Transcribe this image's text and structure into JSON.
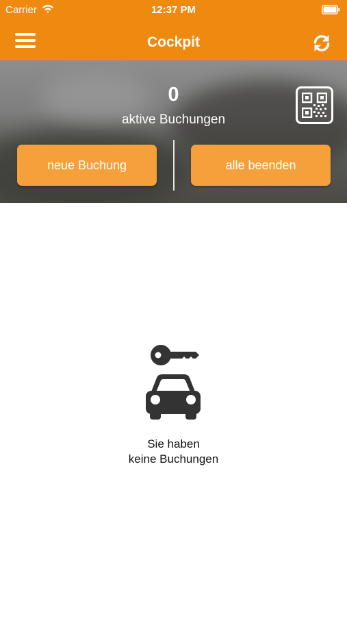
{
  "status_bar": {
    "carrier": "Carrier",
    "time": "12:37 PM",
    "icons": [
      "wifi-icon",
      "battery-icon"
    ]
  },
  "nav_bar": {
    "title": "Cockpit",
    "left_icon": "hamburger-menu-icon",
    "right_icon": "refresh-icon"
  },
  "summary": {
    "active_count": "0",
    "active_label": "aktive Buchungen",
    "qr_icon": "qr-code-icon",
    "new_booking_label": "neue Buchung",
    "end_all_label": "alle beenden"
  },
  "empty_state": {
    "icon": "car-key-icon",
    "line1": "Sie haben",
    "line2": "keine Buchungen"
  },
  "colors": {
    "brand_orange": "#f0890f",
    "button_orange": "#f5a03a",
    "icon_dark": "#333333"
  }
}
